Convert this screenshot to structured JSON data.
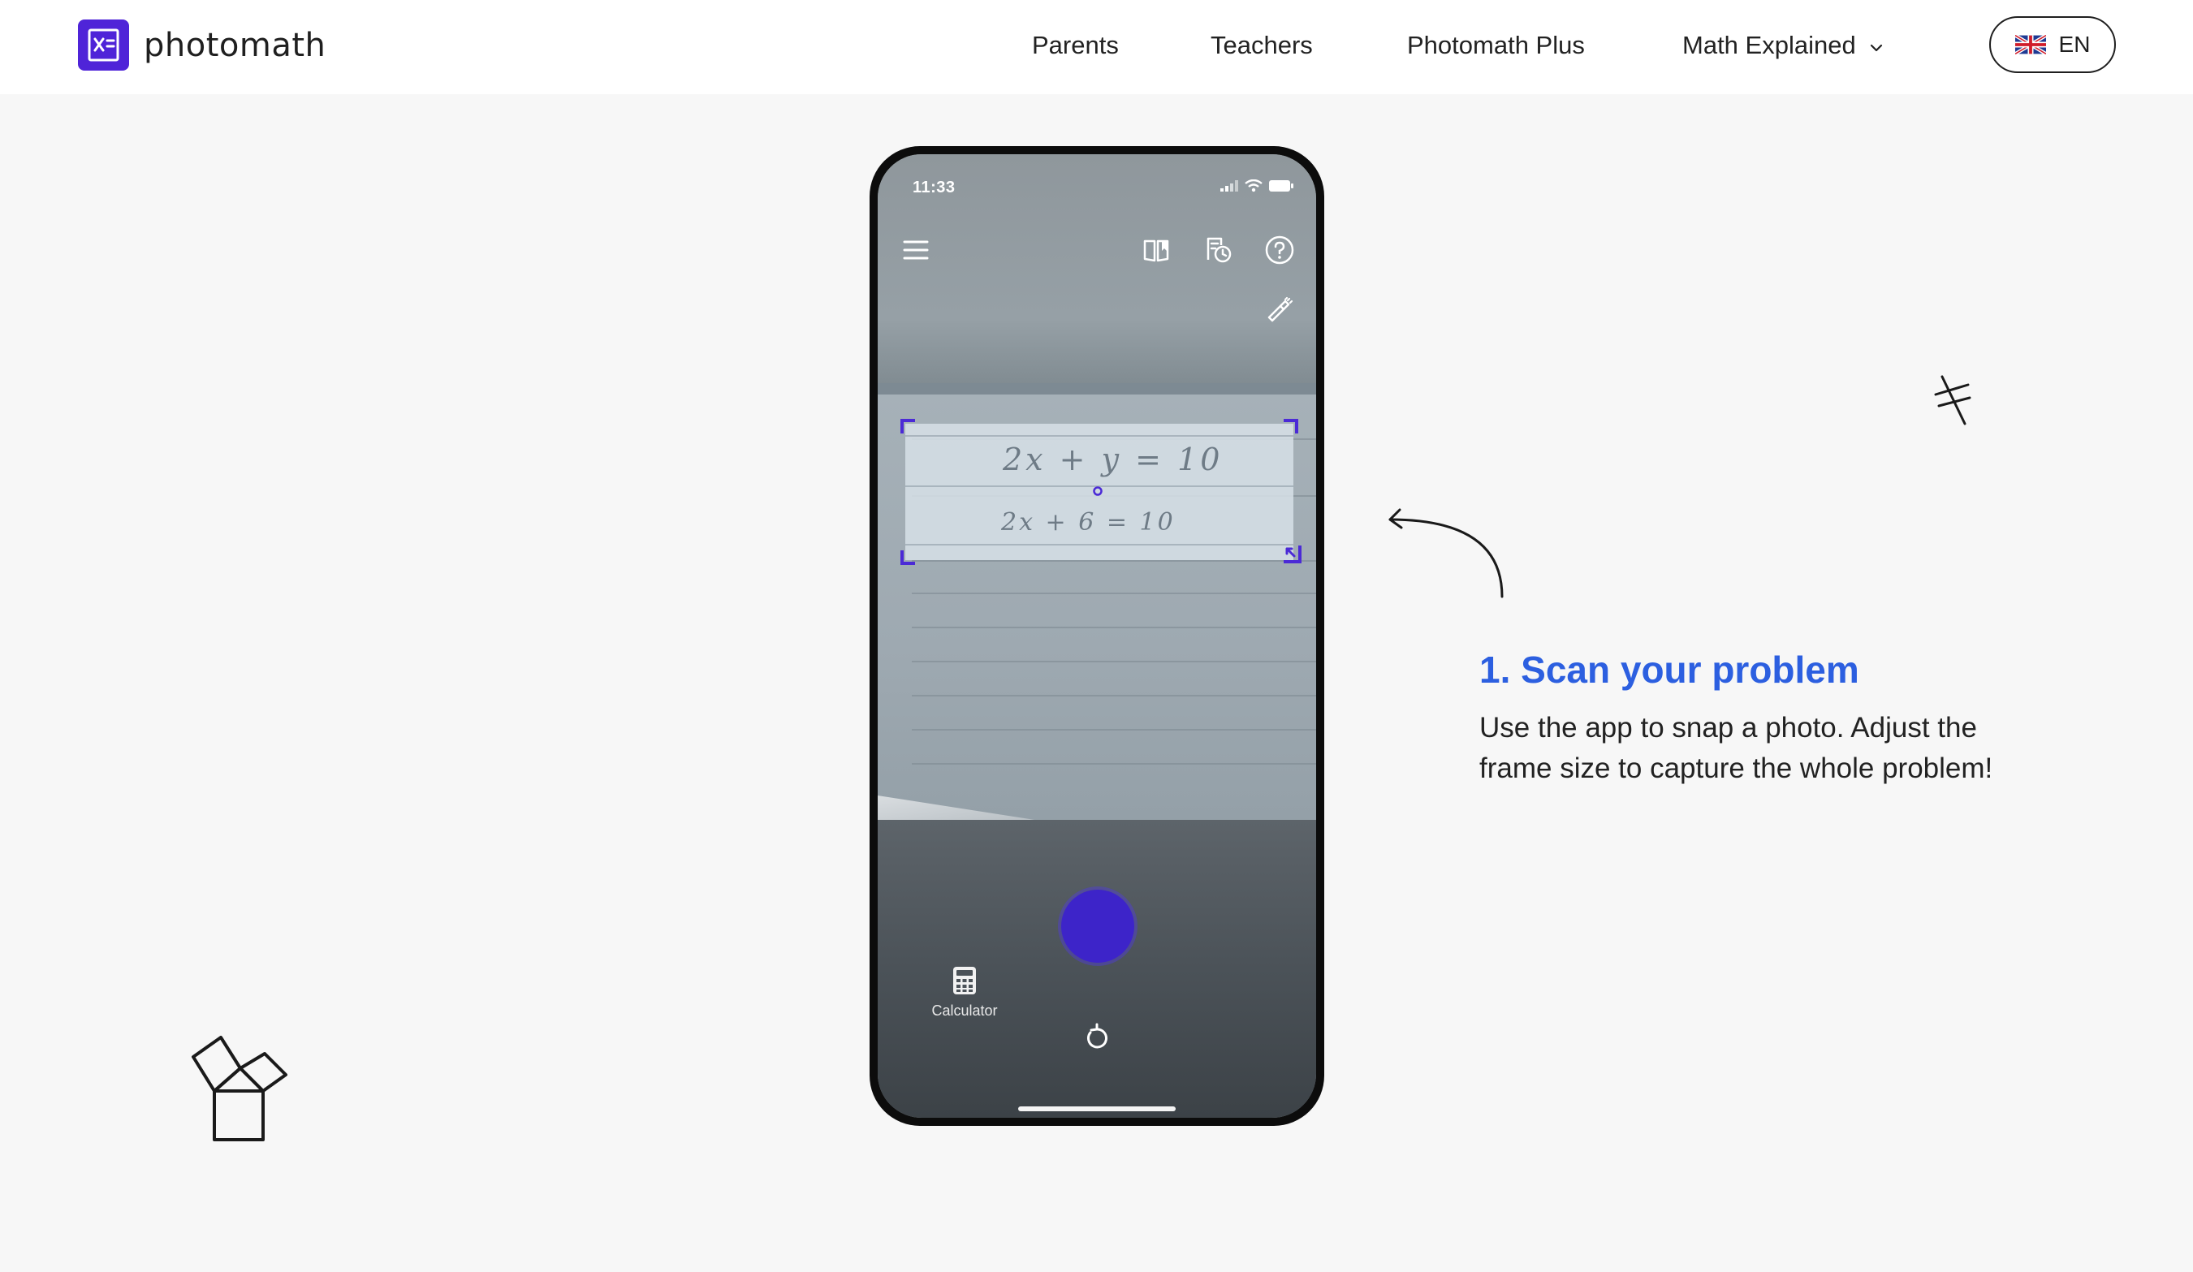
{
  "header": {
    "logo_text": "photomath",
    "nav": {
      "parents": "Parents",
      "teachers": "Teachers",
      "plus": "Photomath Plus",
      "explained": "Math Explained"
    },
    "language": "EN"
  },
  "phone": {
    "status_time": "11:33",
    "equation_1": "2x + y = 10",
    "equation_2": "2x + 6 = 10",
    "calculator_label": "Calculator"
  },
  "step": {
    "title": "1. Scan your problem",
    "description": "Use the app to snap a photo. Adjust the frame size to capture the whole problem!"
  },
  "colors": {
    "brand": "#4f24d8",
    "accent_blue": "#2c5fe0",
    "shutter": "#3d24c9"
  },
  "icons": [
    "logo-icon",
    "chevron-down-icon",
    "uk-flag-icon",
    "menu-icon",
    "book-icon",
    "history-icon",
    "help-icon",
    "flashlight-icon",
    "calculator-icon",
    "redo-icon",
    "arrow-doodle-icon",
    "math-symbol-doodle-icon",
    "pythagoras-doodle-icon"
  ]
}
